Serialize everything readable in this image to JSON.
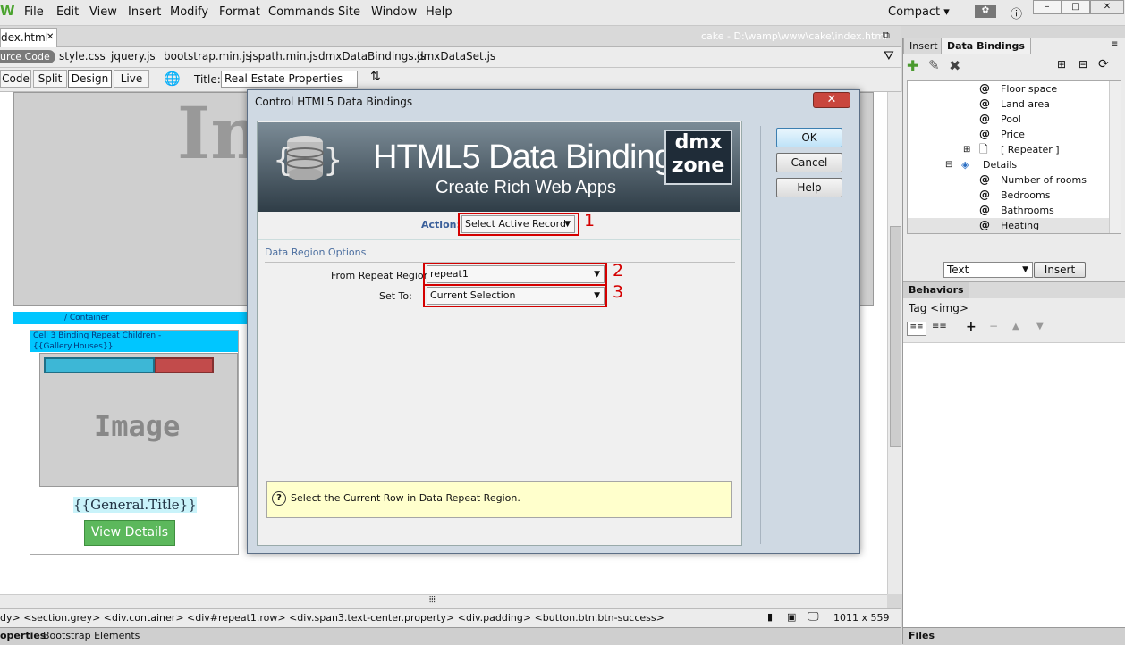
{
  "menubar": {
    "logo": "W",
    "items": [
      "File",
      "Edit",
      "View",
      "Insert",
      "Modify",
      "Format",
      "Commands",
      "Site",
      "Window",
      "Help"
    ],
    "workspace": "Compact"
  },
  "doc": {
    "tab": "dex.html",
    "path": "cake - D:\\wamp\\www\\cake\\index.html",
    "source_code": "urce Code",
    "related_files": [
      "style.css",
      "jquery.js",
      "bootstrap.min.js",
      "jspath.min.js",
      "dmxDataBindings.js",
      "dmxDataSet.js"
    ]
  },
  "toolbar": {
    "views": [
      "Code",
      "Split",
      "Design",
      "Live"
    ],
    "title_label": "Title:",
    "title_value": "Real Estate Properties"
  },
  "design": {
    "big_image_text": "In",
    "container_label": "/ Container",
    "cell_label": "Cell 3 Binding Repeat Children - {{Gallery.Houses}}",
    "image_text": "Image",
    "title_binding": "{{General.Title}}",
    "button": "View Details"
  },
  "statusbar": {
    "tag_path": "dy> <section.grey> <div.container> <div#repeat1.row> <div.span3.text-center.property> <div.padding> <button.btn.btn-success>",
    "size": "1011 x 559"
  },
  "bottom_tabs": [
    "operties",
    "Bootstrap Elements"
  ],
  "panel": {
    "tabs": [
      "Insert",
      "Data Bindings"
    ],
    "tree": [
      {
        "label": "Floor space",
        "indent": 1
      },
      {
        "label": "Land area",
        "indent": 1
      },
      {
        "label": "Pool",
        "indent": 1
      },
      {
        "label": "Price",
        "indent": 1
      },
      {
        "label": "[ Repeater ]",
        "indent": 1
      },
      {
        "label": "Details",
        "indent": 0
      },
      {
        "label": "Number of rooms",
        "indent": 1
      },
      {
        "label": "Bedrooms",
        "indent": 1
      },
      {
        "label": "Bathrooms",
        "indent": 1
      },
      {
        "label": "Heating",
        "indent": 1
      }
    ],
    "insert_type": "Text",
    "insert_button": "Insert",
    "behaviors_tab": "Behaviors",
    "behaviors_tag": "Tag <img>",
    "files_tab": "Files"
  },
  "dialog": {
    "title": "Control HTML5 Data Bindings",
    "banner_title": "HTML5 Data Bindings",
    "banner_sub": "Create Rich Web Apps",
    "logo_line1": "dmx",
    "logo_line2": "zone",
    "action_label": "Action:",
    "action_value": "Select Active Record",
    "section": "Data Region Options",
    "from_label": "From Repeat Region:",
    "from_value": "repeat1",
    "setto_label": "Set To:",
    "setto_value": "Current Selection",
    "annotations": [
      "1",
      "2",
      "3"
    ],
    "hint": "Select the Current Row in Data Repeat Region.",
    "buttons": {
      "ok": "OK",
      "cancel": "Cancel",
      "help": "Help"
    }
  }
}
